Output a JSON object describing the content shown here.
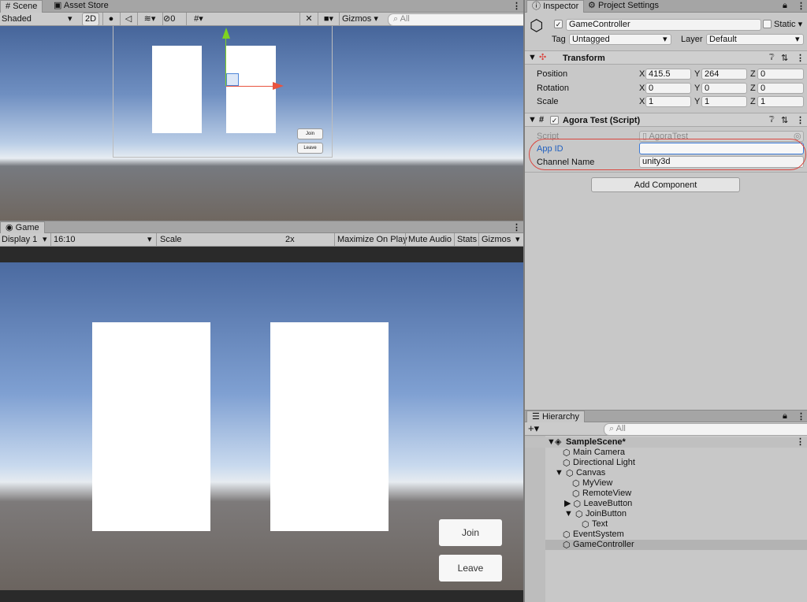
{
  "scene": {
    "tabs": [
      {
        "label": "Scene",
        "active": true
      },
      {
        "label": "Asset Store",
        "active": false
      }
    ],
    "toolbar": {
      "shading": "Shaded",
      "mode_2d": "2D",
      "gizmo_count": "0",
      "gizmos": "Gizmos",
      "search_placeholder": "All"
    },
    "buttons": {
      "join": "Join",
      "leave": "Leave"
    }
  },
  "game": {
    "tab": "Game",
    "toolbar": {
      "display": "Display 1",
      "aspect": "16:10",
      "scale_label": "Scale",
      "scale_value": "2x",
      "maximize": "Maximize On Play",
      "mute": "Mute Audio",
      "stats": "Stats",
      "gizmos": "Gizmos"
    },
    "buttons": {
      "join": "Join",
      "leave": "Leave"
    }
  },
  "inspector": {
    "tabs": [
      {
        "label": "Inspector",
        "active": true
      },
      {
        "label": "Project Settings",
        "active": false
      }
    ],
    "object": {
      "name": "GameController",
      "static_label": "Static",
      "tag_label": "Tag",
      "tag_value": "Untagged",
      "layer_label": "Layer",
      "layer_value": "Default"
    },
    "transform": {
      "title": "Transform",
      "rows": [
        {
          "label": "Position",
          "x": "415.5",
          "y": "264",
          "z": "0"
        },
        {
          "label": "Rotation",
          "x": "0",
          "y": "0",
          "z": "0"
        },
        {
          "label": "Scale",
          "x": "1",
          "y": "1",
          "z": "1"
        }
      ],
      "axis": {
        "x": "X",
        "y": "Y",
        "z": "Z"
      }
    },
    "script_component": {
      "title": "Agora Test (Script)",
      "script_label": "Script",
      "script_value": "AgoraTest",
      "app_id_label": "App ID",
      "app_id_value": "",
      "channel_label": "Channel Name",
      "channel_value": "unity3d"
    },
    "add_component": "Add Component"
  },
  "hierarchy": {
    "tab": "Hierarchy",
    "search_placeholder": "All",
    "items": [
      {
        "label": "SampleScene*"
      },
      {
        "label": "Main Camera"
      },
      {
        "label": "Directional Light"
      },
      {
        "label": "Canvas"
      },
      {
        "label": "MyView"
      },
      {
        "label": "RemoteView"
      },
      {
        "label": "LeaveButton"
      },
      {
        "label": "JoinButton"
      },
      {
        "label": "Text"
      },
      {
        "label": "EventSystem"
      },
      {
        "label": "GameController"
      }
    ]
  },
  "colors": {
    "accent": "#1f5fbf",
    "highlight_oval": "#d9463f",
    "selected_row": "#b3b3b3"
  }
}
